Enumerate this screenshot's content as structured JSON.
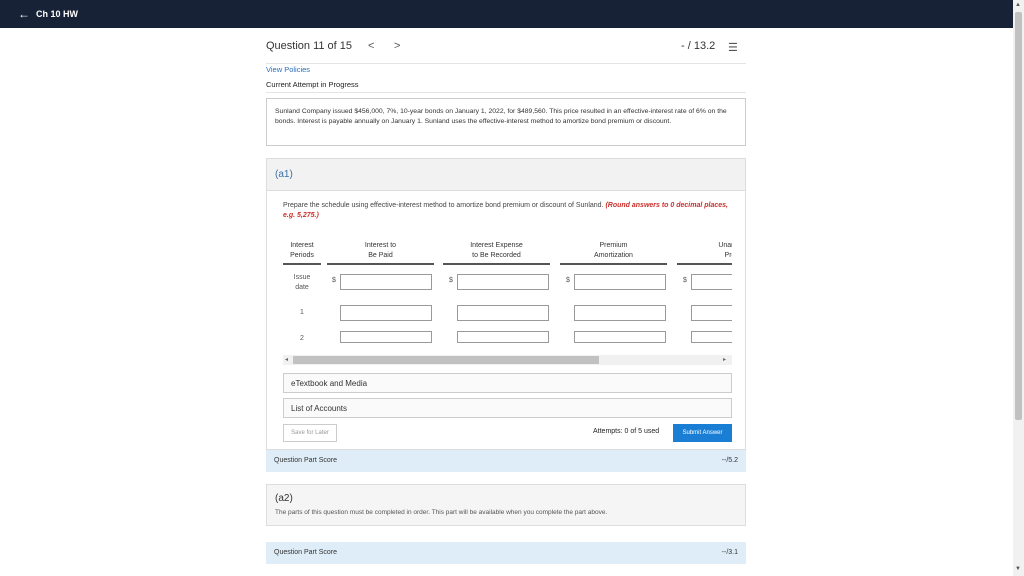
{
  "topbar": {
    "back_glyph": "←",
    "title": "Ch 10 HW"
  },
  "question_header": {
    "label": "Question 11 of 15",
    "prev_glyph": "<",
    "next_glyph": ">",
    "score": "- / 13.2",
    "list_glyph": "☰"
  },
  "links": {
    "view_policies": "View Policies"
  },
  "attempt_status": "Current Attempt in Progress",
  "problem_text": "Sunland Company issued $456,000, 7%, 10-year bonds on January 1, 2022, for $489,560. This price resulted in an effective-interest rate of 6% on the bonds. Interest is payable annually on January 1. Sunland uses the effective-interest method to amortize bond premium or discount.",
  "part_a1": {
    "label": "(a1)",
    "instructions": "Prepare the schedule using effective-interest method to amortize bond premium or discount of Sunland.",
    "round_note": "(Round answers to 0 decimal places, e.g. 5,275.)",
    "columns": [
      {
        "line1": "Interest",
        "line2": "Periods"
      },
      {
        "line1": "Interest to",
        "line2": "Be Paid"
      },
      {
        "line1": "Interest Expense",
        "line2": "to Be Recorded"
      },
      {
        "line1": "Premium",
        "line2": "Amortization"
      },
      {
        "line1": "Unam",
        "line2": "Prei"
      }
    ],
    "rows": [
      {
        "line1": "Issue",
        "line2": "date"
      },
      {
        "line1": "1",
        "line2": ""
      },
      {
        "line1": "2",
        "line2": ""
      }
    ],
    "currency": "$",
    "scroll_left_glyph": "◂",
    "scroll_right_glyph": "▸",
    "etextbook": "eTextbook and Media",
    "list_accounts": "List of Accounts",
    "save_label": "Save for Later",
    "attempts": "Attempts: 0 of 5 used",
    "submit_label": "Submit Answer"
  },
  "score_a1": {
    "label": "Question Part Score",
    "value": "--/5.2"
  },
  "part_a2": {
    "label": "(a2)",
    "note": "The parts of this question must be completed in order. This part will be available when you complete the part above."
  },
  "score_a2": {
    "label": "Question Part Score",
    "value": "--/3.1"
  },
  "colors": {
    "topbar": "#172236",
    "link": "#2a6ebb",
    "submit": "#1a7fd4",
    "score_bar": "#deedf7",
    "round_note": "#c9302c"
  }
}
